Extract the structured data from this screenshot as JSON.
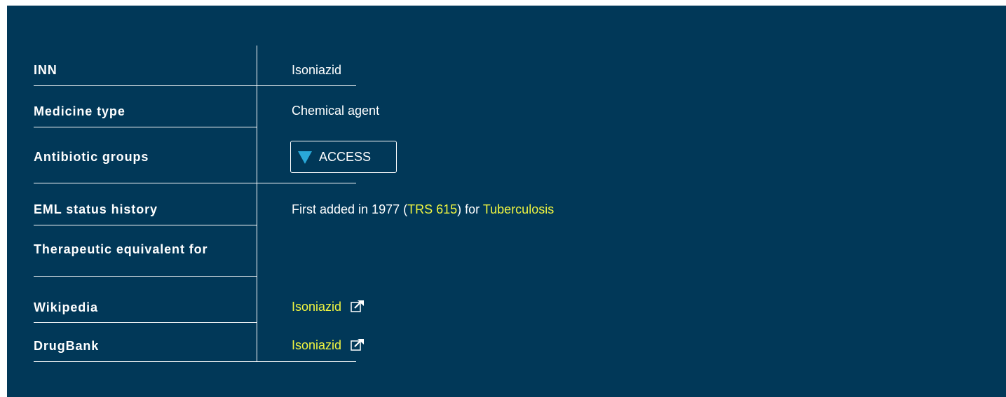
{
  "colors": {
    "background": "#013858",
    "link": "#f0f540",
    "access_icon": "#29a8d8",
    "text": "#ffffff"
  },
  "rows": [
    {
      "label": "INN",
      "value": "Isoniazid"
    },
    {
      "label": "Medicine type",
      "value": "Chemical agent"
    },
    {
      "label": "Antibiotic groups",
      "badge_icon": "triangle-down-icon",
      "badge": "ACCESS"
    },
    {
      "label": "EML status history",
      "value_prefix": "First added in 1977 (",
      "value_link1": "TRS 615",
      "value_mid": ") for ",
      "value_link2": "Tuberculosis"
    },
    {
      "label": "Therapeutic equivalent for",
      "value": ""
    },
    {
      "label": "Wikipedia",
      "link": "Isoniazid",
      "icon": "external-link-icon"
    },
    {
      "label": "DrugBank",
      "link": "Isoniazid",
      "icon": "external-link-icon"
    }
  ]
}
